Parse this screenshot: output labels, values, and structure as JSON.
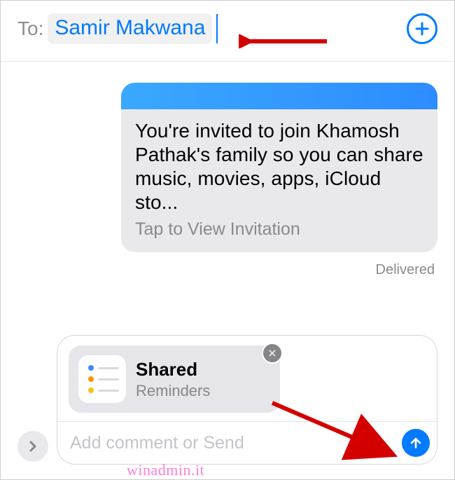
{
  "header": {
    "to_label": "To:",
    "recipient_name": "Samir Makwana",
    "add_icon": "plus-circle"
  },
  "message": {
    "invitation_text": "You're invited to join Khamosh Pathak's family so you can share music, movies, apps, iCloud sto...",
    "tap_prompt": "Tap to View Invitation",
    "status": "Delivered"
  },
  "compose": {
    "attachment": {
      "title": "Shared",
      "app_name": "Reminders",
      "icon_name": "reminders-app-icon",
      "close_icon": "x-icon"
    },
    "placeholder": "Add comment or Send",
    "expand_icon": "chevron-right",
    "send_icon": "arrow-up"
  },
  "annotations": {
    "arrow_color": "#d40000"
  },
  "watermark": "winadmin.it"
}
